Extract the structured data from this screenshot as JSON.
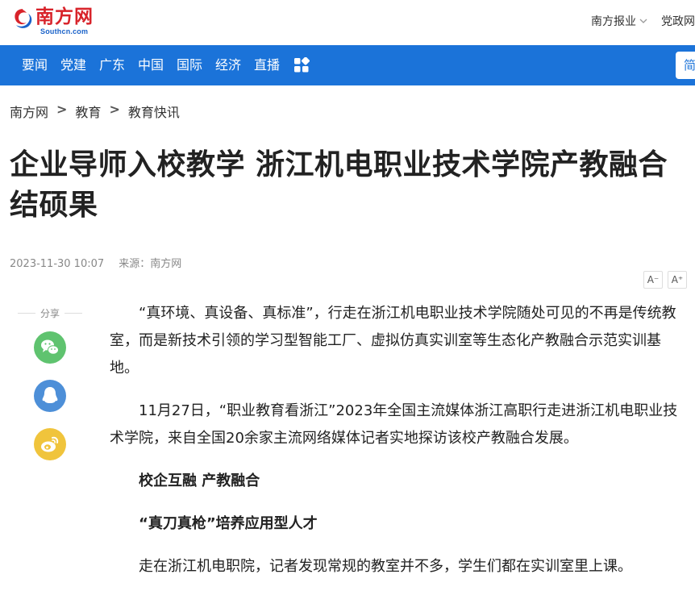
{
  "header": {
    "logo_text": "南方网",
    "logo_sub": "Southcn.com",
    "links": [
      {
        "label": "南方报业",
        "has_dropdown": true
      },
      {
        "label": "党政网",
        "has_dropdown": false
      }
    ]
  },
  "nav": {
    "items": [
      "要闻",
      "党建",
      "广东",
      "中国",
      "国际",
      "经济",
      "直播"
    ],
    "right_label": "简",
    "bg_color": "#1b73d9"
  },
  "breadcrumb": [
    "南方网",
    "教育",
    "教育快讯"
  ],
  "breadcrumb_sep": ">",
  "article": {
    "title": "企业导师入校教学 浙江机电职业技术学院产教融合结硕果",
    "date": "2023-11-30 10:07",
    "source": "来源：南方网",
    "font_decrease": "A⁻",
    "font_increase": "A⁺",
    "paragraphs": [
      {
        "type": "text",
        "text": "“真环境、真设备、真标准”，行走在浙江机电职业技术学院随处可见的不再是传统教室，而是新技术引领的学习型智能工厂、虚拟仿真实训室等生态化产教融合示范实训基地。"
      },
      {
        "type": "text",
        "text": "11月27日，“职业教育看浙江”2023年全国主流媒体浙江高职行走进浙江机电职业技术学院，来自全国20余家主流网络媒体记者实地探访该校产教融合发展。"
      },
      {
        "type": "subheading",
        "text": "校企互融 产教融合"
      },
      {
        "type": "subheading",
        "text": "“真刀真枪”培养应用型人才"
      },
      {
        "type": "text",
        "text": "走在浙江机电职院，记者发现常规的教室并不多，学生们都在实训室里上课。"
      }
    ]
  },
  "share": {
    "label": "分享",
    "buttons": [
      {
        "name": "wechat",
        "color": "#5fc36f"
      },
      {
        "name": "qq",
        "color": "#4d8fd8"
      },
      {
        "name": "weibo",
        "color": "#f0c43c"
      }
    ]
  }
}
